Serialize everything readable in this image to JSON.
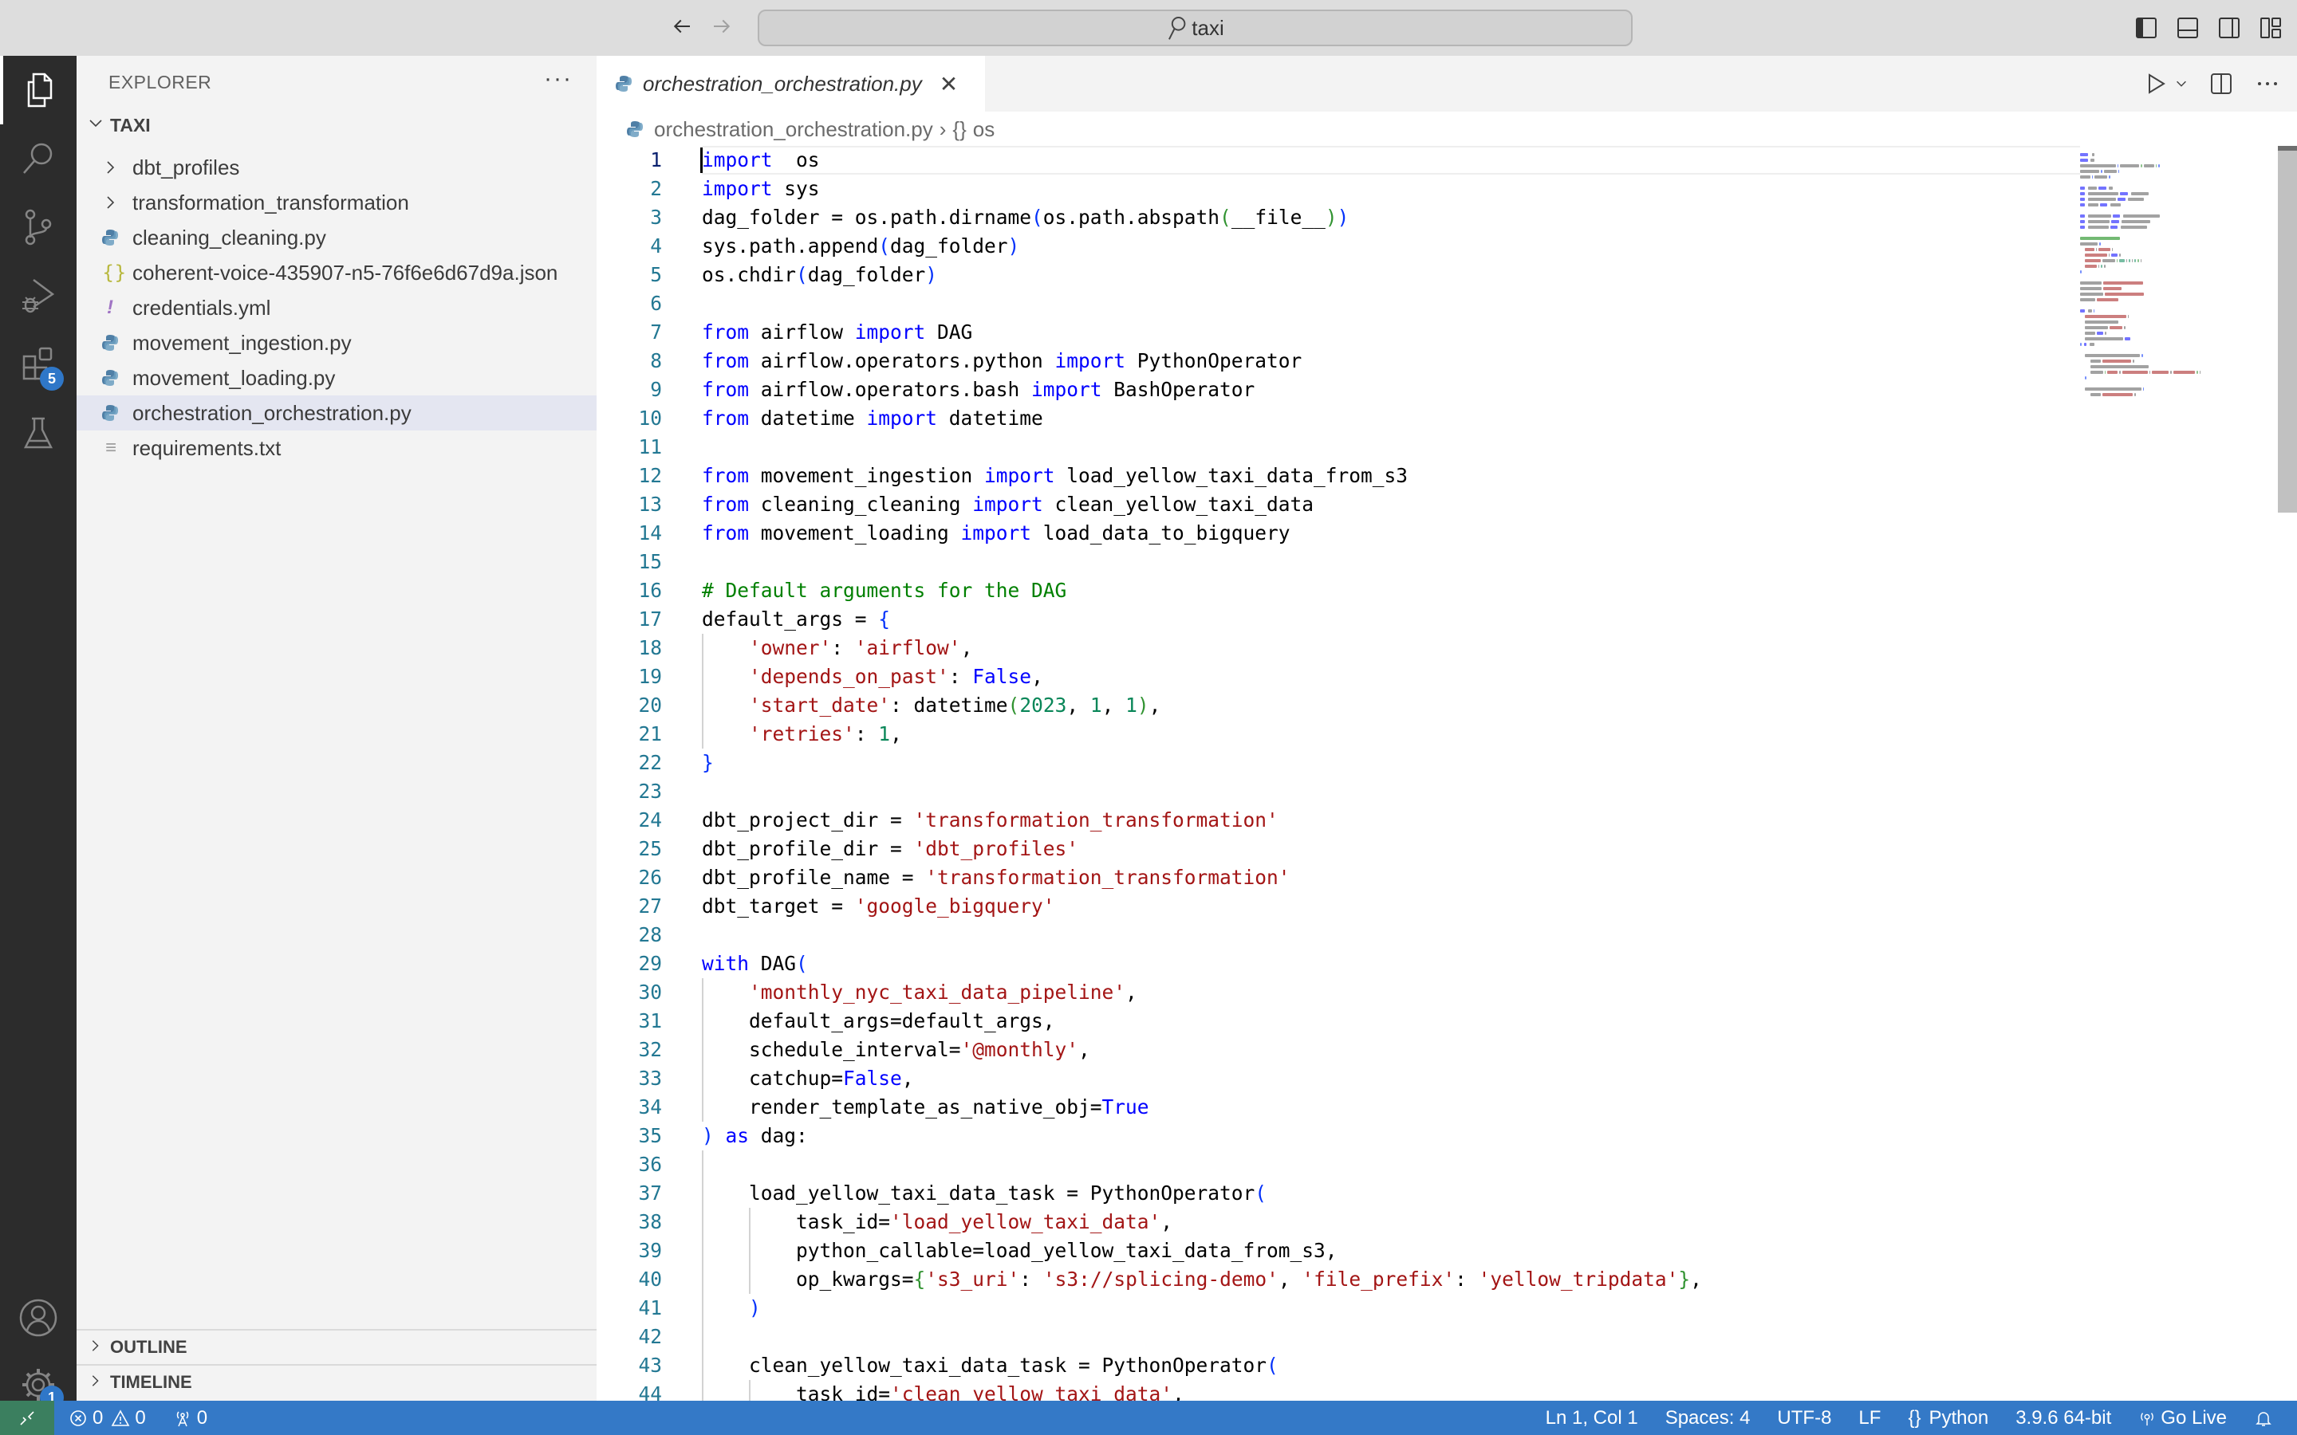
{
  "titlebar": {
    "search_text": "taxi",
    "back_icon": "arrow-left-icon",
    "forward_icon": "arrow-right-icon",
    "layout_icons": [
      "toggle-primary-sidebar-icon",
      "toggle-panel-icon",
      "toggle-secondary-sidebar-icon",
      "customize-layout-icon"
    ]
  },
  "activity_bar": {
    "items": [
      {
        "name": "explorer",
        "icon": "files-icon",
        "active": true
      },
      {
        "name": "search",
        "icon": "search-icon"
      },
      {
        "name": "source-control",
        "icon": "source-control-icon"
      },
      {
        "name": "run-debug",
        "icon": "run-debug-icon"
      },
      {
        "name": "extensions",
        "icon": "extensions-icon",
        "badge": "5"
      },
      {
        "name": "testing",
        "icon": "beaker-icon"
      }
    ],
    "bottom": [
      {
        "name": "accounts",
        "icon": "account-icon"
      },
      {
        "name": "manage",
        "icon": "gear-icon",
        "badge": "1"
      }
    ]
  },
  "sidebar": {
    "title": "EXPLORER",
    "more": "···",
    "root": "TAXI",
    "items": [
      {
        "label": "dbt_profiles",
        "type": "folder"
      },
      {
        "label": "transformation_transformation",
        "type": "folder"
      },
      {
        "label": "cleaning_cleaning.py",
        "type": "python"
      },
      {
        "label": "coherent-voice-435907-n5-76f6e6d67d9a.json",
        "type": "json"
      },
      {
        "label": "credentials.yml",
        "type": "yaml"
      },
      {
        "label": "movement_ingestion.py",
        "type": "python"
      },
      {
        "label": "movement_loading.py",
        "type": "python"
      },
      {
        "label": "orchestration_orchestration.py",
        "type": "python",
        "selected": true
      },
      {
        "label": "requirements.txt",
        "type": "text"
      }
    ],
    "sections": [
      "OUTLINE",
      "TIMELINE"
    ]
  },
  "editor": {
    "tab_label": "orchestration_orchestration.py",
    "breadcrumb": {
      "file": "orchestration_orchestration.py",
      "symbol_icon": "{}",
      "symbol": "os"
    },
    "lines": [
      [
        [
          "kw",
          "import"
        ],
        [
          "",
          "  os"
        ]
      ],
      [
        [
          "kw",
          "import"
        ],
        [
          "",
          " sys"
        ]
      ],
      [
        [
          "",
          "dag_folder = os.path.dirname"
        ],
        [
          "br1",
          "("
        ],
        [
          "",
          "os.path.abspath"
        ],
        [
          "br2",
          "("
        ],
        [
          "",
          "__file__"
        ],
        [
          "br2",
          ")"
        ],
        [
          "br1",
          ")"
        ]
      ],
      [
        [
          "",
          "sys.path.append"
        ],
        [
          "br1",
          "("
        ],
        [
          "",
          "dag_folder"
        ],
        [
          "br1",
          ")"
        ]
      ],
      [
        [
          "",
          "os.chdir"
        ],
        [
          "br1",
          "("
        ],
        [
          "",
          "dag_folder"
        ],
        [
          "br1",
          ")"
        ]
      ],
      [],
      [
        [
          "kw",
          "from"
        ],
        [
          "",
          " airflow "
        ],
        [
          "kw",
          "import"
        ],
        [
          "",
          " DAG"
        ]
      ],
      [
        [
          "kw",
          "from"
        ],
        [
          "",
          " airflow.operators.python "
        ],
        [
          "kw",
          "import"
        ],
        [
          "",
          " PythonOperator"
        ]
      ],
      [
        [
          "kw",
          "from"
        ],
        [
          "",
          " airflow.operators.bash "
        ],
        [
          "kw",
          "import"
        ],
        [
          "",
          " BashOperator"
        ]
      ],
      [
        [
          "kw",
          "from"
        ],
        [
          "",
          " datetime "
        ],
        [
          "kw",
          "import"
        ],
        [
          "",
          " datetime"
        ]
      ],
      [],
      [
        [
          "kw",
          "from"
        ],
        [
          "",
          " movement_ingestion "
        ],
        [
          "kw",
          "import"
        ],
        [
          "",
          " load_yellow_taxi_data_from_s3"
        ]
      ],
      [
        [
          "kw",
          "from"
        ],
        [
          "",
          " cleaning_cleaning "
        ],
        [
          "kw",
          "import"
        ],
        [
          "",
          " clean_yellow_taxi_data"
        ]
      ],
      [
        [
          "kw",
          "from"
        ],
        [
          "",
          " movement_loading "
        ],
        [
          "kw",
          "import"
        ],
        [
          "",
          " load_data_to_bigquery"
        ]
      ],
      [],
      [
        [
          "cmt",
          "# Default arguments for the DAG"
        ]
      ],
      [
        [
          "",
          "default_args = "
        ],
        [
          "br1",
          "{"
        ]
      ],
      [
        [
          "",
          "    "
        ],
        [
          "str",
          "'owner'"
        ],
        [
          "",
          ": "
        ],
        [
          "str",
          "'airflow'"
        ],
        [
          "",
          ","
        ]
      ],
      [
        [
          "",
          "    "
        ],
        [
          "str",
          "'depends_on_past'"
        ],
        [
          "",
          ": "
        ],
        [
          "kw",
          "False"
        ],
        [
          "",
          ","
        ]
      ],
      [
        [
          "",
          "    "
        ],
        [
          "str",
          "'start_date'"
        ],
        [
          "",
          ": datetime"
        ],
        [
          "br2",
          "("
        ],
        [
          "num",
          "2023"
        ],
        [
          "",
          ", "
        ],
        [
          "num",
          "1"
        ],
        [
          "",
          ", "
        ],
        [
          "num",
          "1"
        ],
        [
          "br2",
          ")"
        ],
        [
          "",
          ","
        ]
      ],
      [
        [
          "",
          "    "
        ],
        [
          "str",
          "'retries'"
        ],
        [
          "",
          ": "
        ],
        [
          "num",
          "1"
        ],
        [
          "",
          ","
        ]
      ],
      [
        [
          "br1",
          "}"
        ]
      ],
      [],
      [
        [
          "",
          "dbt_project_dir = "
        ],
        [
          "str",
          "'transformation_transformation'"
        ]
      ],
      [
        [
          "",
          "dbt_profile_dir = "
        ],
        [
          "str",
          "'dbt_profiles'"
        ]
      ],
      [
        [
          "",
          "dbt_profile_name = "
        ],
        [
          "str",
          "'transformation_transformation'"
        ]
      ],
      [
        [
          "",
          "dbt_target = "
        ],
        [
          "str",
          "'google_bigquery'"
        ]
      ],
      [],
      [
        [
          "kw",
          "with"
        ],
        [
          "",
          " DAG"
        ],
        [
          "br1",
          "("
        ]
      ],
      [
        [
          "",
          "    "
        ],
        [
          "str",
          "'monthly_nyc_taxi_data_pipeline'"
        ],
        [
          "",
          ","
        ]
      ],
      [
        [
          "",
          "    default_args=default_args,"
        ]
      ],
      [
        [
          "",
          "    schedule_interval="
        ],
        [
          "str",
          "'@monthly'"
        ],
        [
          "",
          ","
        ]
      ],
      [
        [
          "",
          "    catchup="
        ],
        [
          "kw",
          "False"
        ],
        [
          "",
          ","
        ]
      ],
      [
        [
          "",
          "    render_template_as_native_obj="
        ],
        [
          "kw",
          "True"
        ]
      ],
      [
        [
          "br1",
          ")"
        ],
        [
          "kw",
          " as"
        ],
        [
          "",
          " dag:"
        ]
      ],
      [],
      [
        [
          "",
          "    load_yellow_taxi_data_task = PythonOperator"
        ],
        [
          "br1",
          "("
        ]
      ],
      [
        [
          "",
          "        task_id="
        ],
        [
          "str",
          "'load_yellow_taxi_data'"
        ],
        [
          "",
          ","
        ]
      ],
      [
        [
          "",
          "        python_callable=load_yellow_taxi_data_from_s3,"
        ]
      ],
      [
        [
          "",
          "        op_kwargs="
        ],
        [
          "br2",
          "{"
        ],
        [
          "str",
          "'s3_uri'"
        ],
        [
          "",
          ": "
        ],
        [
          "str",
          "'s3://splicing-demo'"
        ],
        [
          "",
          ", "
        ],
        [
          "str",
          "'file_prefix'"
        ],
        [
          "",
          ": "
        ],
        [
          "str",
          "'yellow_tripdata'"
        ],
        [
          "br2",
          "}"
        ],
        [
          "",
          ","
        ]
      ],
      [
        [
          "",
          "    "
        ],
        [
          "br1",
          ")"
        ]
      ],
      [],
      [
        [
          "",
          "    clean_yellow_taxi_data_task = PythonOperator"
        ],
        [
          "br1",
          "("
        ]
      ],
      [
        [
          "",
          "        task_id="
        ],
        [
          "str",
          "'clean_yellow_taxi_data'"
        ],
        [
          "",
          ","
        ]
      ]
    ]
  },
  "statusbar": {
    "errors": "0",
    "warnings": "0",
    "ports": "0",
    "position": "Ln 1, Col 1",
    "spaces": "Spaces: 4",
    "encoding": "UTF-8",
    "eol": "LF",
    "language_icon": "{}",
    "language": "Python",
    "interpreter": "3.9.6 64-bit",
    "go_live": "Go Live"
  },
  "colors": {
    "statusbar": "#3479c7",
    "remote": "#3b7f5f",
    "activitybar": "#2c2c2c",
    "sidebar": "#f3f3f3",
    "selected_item": "#e4e6f1",
    "badge": "#2f77c8"
  }
}
